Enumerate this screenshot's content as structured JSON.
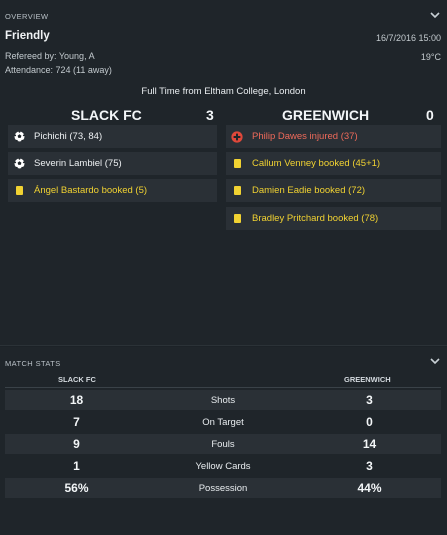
{
  "overview": {
    "section_title": "OVERVIEW",
    "match_type": "Friendly",
    "referee": "Refereed by: Young, A",
    "attendance": "Attendance: 724 (11 away)",
    "date": "16/7/2016 15:00",
    "temperature": "19°C",
    "venue": "Full Time from Eltham College, London",
    "home": {
      "name": "SLACK FC",
      "score": "3",
      "events": [
        {
          "icon": "ball-icon",
          "text": "Pichichi (73, 84)",
          "style": "white"
        },
        {
          "icon": "ball-icon",
          "text": "Severin Lambiel (75)",
          "style": "white"
        },
        {
          "icon": "yellow-card-icon",
          "text": "Ángel Bastardo booked (5)",
          "style": "yellow"
        }
      ]
    },
    "away": {
      "name": "GREENWICH",
      "score": "0",
      "events": [
        {
          "icon": "injury-icon",
          "text": "Philip Dawes injured (37)",
          "style": "red"
        },
        {
          "icon": "yellow-card-icon",
          "text": "Callum Venney booked (45+1)",
          "style": "yellow"
        },
        {
          "icon": "yellow-card-icon",
          "text": "Damien Eadie booked (72)",
          "style": "yellow"
        },
        {
          "icon": "yellow-card-icon",
          "text": "Bradley Pritchard booked (78)",
          "style": "yellow"
        }
      ]
    }
  },
  "match_stats": {
    "section_title": "MATCH STATS",
    "home_label": "SLACK FC",
    "away_label": "GREENWICH",
    "rows": [
      {
        "home": "18",
        "label": "Shots",
        "away": "3"
      },
      {
        "home": "7",
        "label": "On Target",
        "away": "0"
      },
      {
        "home": "9",
        "label": "Fouls",
        "away": "14"
      },
      {
        "home": "1",
        "label": "Yellow Cards",
        "away": "3"
      },
      {
        "home": "56%",
        "label": "Possession",
        "away": "44%"
      }
    ]
  },
  "colors": {
    "background": "#1c2227",
    "row_shade": "#2a3036",
    "yellow_text": "#f1d232",
    "injury_text": "#ef6a5a"
  }
}
